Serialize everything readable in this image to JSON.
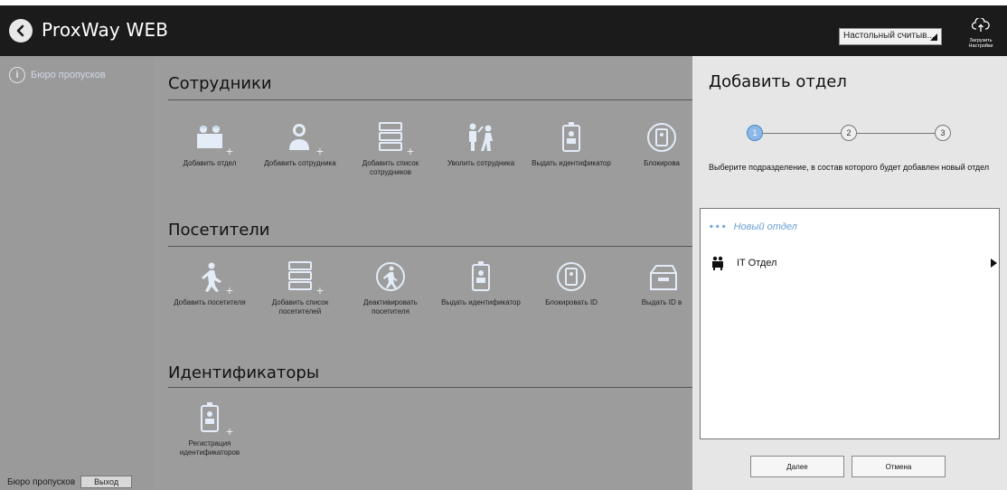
{
  "app": {
    "title": "ProxWay WEB",
    "reader_select": "Настольный считыв...",
    "upload_settings_label": "Загрузить Настройки"
  },
  "sidebar": {
    "item_label": "Бюро пропусков",
    "footer_label": "Бюро пропусков",
    "logout_label": "Выход"
  },
  "sections": {
    "employees": {
      "title": "Сотрудники",
      "tiles": [
        {
          "label": "Добавить отдел",
          "icon": "add-department-icon"
        },
        {
          "label": "Добавить сотрудника",
          "icon": "add-employee-icon"
        },
        {
          "label": "Добавить список сотрудников",
          "icon": "add-employee-list-icon"
        },
        {
          "label": "Уволить сотрудника",
          "icon": "dismiss-employee-icon"
        },
        {
          "label": "Выдать идентификатор",
          "icon": "issue-id-icon"
        },
        {
          "label": "Блокирова",
          "icon": "block-id-icon"
        }
      ]
    },
    "visitors": {
      "title": "Посетители",
      "tiles": [
        {
          "label": "Добавить посетителя",
          "icon": "add-visitor-icon"
        },
        {
          "label": "Добавить список посетителей",
          "icon": "add-visitor-list-icon"
        },
        {
          "label": "Деактивировать посетителя",
          "icon": "deactivate-visitor-icon"
        },
        {
          "label": "Выдать идентификатор",
          "icon": "issue-id-icon"
        },
        {
          "label": "Блокировать ID",
          "icon": "block-id-icon"
        },
        {
          "label": "Выдать ID в",
          "icon": "id-box-icon"
        }
      ]
    },
    "identifiers": {
      "title": "Идентификаторы",
      "tiles": [
        {
          "label": "Регистрация идентификаторов",
          "icon": "register-id-icon"
        }
      ]
    }
  },
  "panel": {
    "title": "Добавить отдел",
    "steps": [
      "1",
      "2",
      "3"
    ],
    "current_step": 1,
    "hint": "Выберите подразделение, в состав которого будет добавлен новый отдел",
    "new_dept": "Новый отдел",
    "dept_items": [
      {
        "label": "IT Отдел"
      }
    ],
    "next_label": "Далее",
    "cancel_label": "Отмена"
  },
  "colors": {
    "topbar": "#1b1b1b",
    "overlay": "#9c9c9c",
    "accent": "#6a9fd6",
    "icon_fill": "#e3ecf7"
  }
}
